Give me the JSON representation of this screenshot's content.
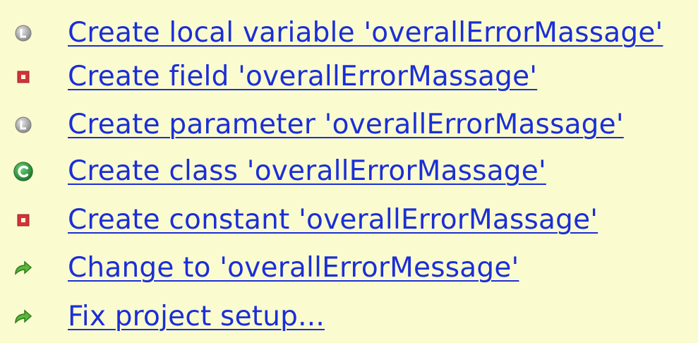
{
  "proposals": [
    {
      "label": "Create local variable 'overallErrorMassage'",
      "icon": "local-variable-icon"
    },
    {
      "label": "Create field 'overallErrorMassage'",
      "icon": "field-icon"
    },
    {
      "label": "Create parameter 'overallErrorMassage'",
      "icon": "local-variable-icon"
    },
    {
      "label": "Create class 'overallErrorMassage'",
      "icon": "class-icon"
    },
    {
      "label": "Create constant 'overallErrorMassage'",
      "icon": "field-icon"
    },
    {
      "label": "Change to 'overallErrorMessage'",
      "icon": "change-arrow-icon"
    },
    {
      "label": "Fix project setup...",
      "icon": "change-arrow-icon"
    }
  ],
  "colors": {
    "background": "#fbfbd0",
    "link": "#1a2fd6",
    "class_icon": "#2e8b3a",
    "field_icon": "#d2323c",
    "local_icon": "#9a9a9a",
    "arrow_icon": "#3a9a2a"
  }
}
